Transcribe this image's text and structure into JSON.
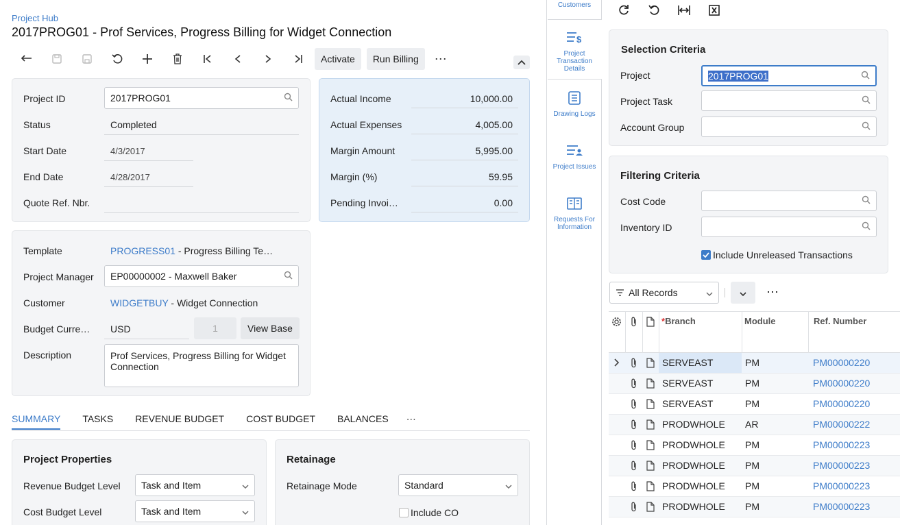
{
  "breadcrumb": "Project Hub",
  "page_title": "2017PROG01 - Prof Services, Progress Billing for Widget Connection",
  "toolbar": {
    "activate_label": "Activate",
    "run_billing_label": "Run Billing",
    "more": "⋯"
  },
  "summary": {
    "project_id_label": "Project ID",
    "project_id": "2017PROG01",
    "status_label": "Status",
    "status": "Completed",
    "start_date_label": "Start Date",
    "start_date": "4/3/2017",
    "end_date_label": "End Date",
    "end_date": "4/28/2017",
    "quote_label": "Quote Ref. Nbr.",
    "quote": ""
  },
  "financials": {
    "actual_income_label": "Actual Income",
    "actual_income": "10,000.00",
    "actual_expenses_label": "Actual Expenses",
    "actual_expenses": "4,005.00",
    "margin_amount_label": "Margin Amount",
    "margin_amount": "5,995.00",
    "margin_pct_label": "Margin (%)",
    "margin_pct": "59.95",
    "pending_label": "Pending Invoi…",
    "pending": "0.00"
  },
  "details": {
    "template_label": "Template",
    "template_code": "PROGRESS01",
    "template_desc": " - Progress Billing Te…",
    "pm_label": "Project Manager",
    "pm": "EP00000002 - Maxwell Baker",
    "customer_label": "Customer",
    "customer_code": "WIDGETBUY",
    "customer_desc": " - Widget Connection",
    "currency_label": "Budget Curre…",
    "currency": "USD",
    "rate": "1",
    "view_base_label": "View Base",
    "description_label": "Description",
    "description": "Prof Services, Progress Billing for Widget Connection"
  },
  "tabs": [
    "SUMMARY",
    "TASKS",
    "REVENUE BUDGET",
    "COST BUDGET",
    "BALANCES",
    "⋯"
  ],
  "props": {
    "title": "Project Properties",
    "revenue_level_label": "Revenue Budget Level",
    "revenue_level": "Task and Item",
    "cost_level_label": "Cost Budget Level",
    "cost_level": "Task and Item"
  },
  "retainage": {
    "title": "Retainage",
    "mode_label": "Retainage Mode",
    "mode": "Standard",
    "include_co_label": "Include CO"
  },
  "sidebar": {
    "customers_label": "Customers",
    "items": [
      {
        "label": "Project Transaction Details",
        "icon": "transaction-details-icon"
      },
      {
        "label": "Drawing Logs",
        "icon": "drawing-logs-icon"
      },
      {
        "label": "Project Issues",
        "icon": "project-issues-icon"
      },
      {
        "label": "Requests For Information",
        "icon": "rfi-icon"
      }
    ]
  },
  "selection": {
    "title": "Selection Criteria",
    "project_label": "Project",
    "project": "2017PROG01",
    "task_label": "Project Task",
    "task": "",
    "account_group_label": "Account Group",
    "account_group": ""
  },
  "filtering": {
    "title": "Filtering Criteria",
    "cost_code_label": "Cost Code",
    "inventory_label": "Inventory ID",
    "include_unreleased_label": "Include Unreleased Transactions",
    "include_unreleased": true
  },
  "grid": {
    "filter_label": "All Records",
    "columns": [
      "Branch",
      "Module",
      "Ref. Number"
    ],
    "rows": [
      {
        "branch": "SERVEAST",
        "module": "PM",
        "ref": "PM00000220"
      },
      {
        "branch": "SERVEAST",
        "module": "PM",
        "ref": "PM00000220"
      },
      {
        "branch": "SERVEAST",
        "module": "PM",
        "ref": "PM00000220"
      },
      {
        "branch": "PRODWHOLE",
        "module": "AR",
        "ref": "PM00000222"
      },
      {
        "branch": "PRODWHOLE",
        "module": "PM",
        "ref": "PM00000223"
      },
      {
        "branch": "PRODWHOLE",
        "module": "PM",
        "ref": "PM00000223"
      },
      {
        "branch": "PRODWHOLE",
        "module": "PM",
        "ref": "PM00000223"
      },
      {
        "branch": "PRODWHOLE",
        "module": "PM",
        "ref": "PM00000223"
      }
    ]
  },
  "colors": {
    "accent": "#3d7cc9",
    "selected_row": "#e4eef9",
    "panel": "#f4f5f7"
  }
}
